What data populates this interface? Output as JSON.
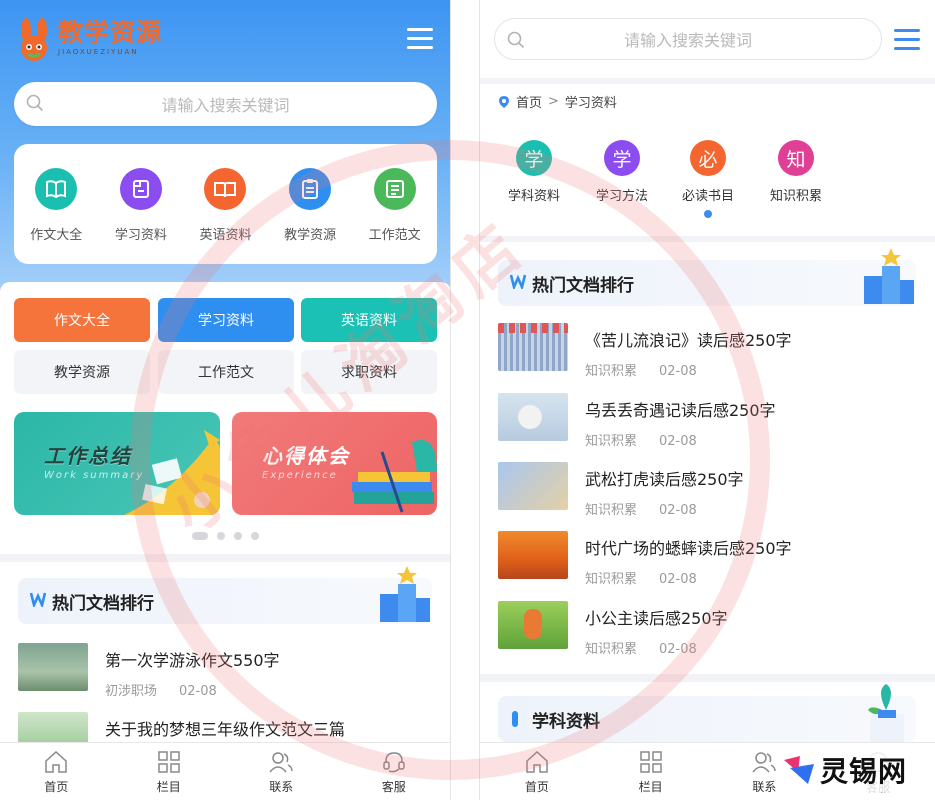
{
  "left": {
    "logo": {
      "title": "教学资源",
      "subtitle": "JIAOXUEZIYUAN"
    },
    "search": {
      "placeholder": "请输入搜索关键词"
    },
    "categories": [
      {
        "label": "作文大全",
        "icon": "book-icon",
        "color": "#1bbfb0"
      },
      {
        "label": "学习资料",
        "icon": "folder-icon",
        "color": "#8b4cf0"
      },
      {
        "label": "英语资料",
        "icon": "open-book-icon",
        "color": "#f4652f"
      },
      {
        "label": "教学资源",
        "icon": "clipboard-icon",
        "color": "#2f8ff0"
      },
      {
        "label": "工作范文",
        "icon": "list-icon",
        "color": "#4bb85a"
      }
    ],
    "pills": [
      {
        "label": "作文大全",
        "color": "#f4743b"
      },
      {
        "label": "学习资料",
        "color": "#2f8ff0"
      },
      {
        "label": "英语资料",
        "color": "#1bc1b4"
      },
      {
        "label": "教学资源",
        "color": ""
      },
      {
        "label": "工作范文",
        "color": ""
      },
      {
        "label": "求职资料",
        "color": ""
      }
    ],
    "banners": [
      {
        "title": "工作总结",
        "subtitle": "Work summary"
      },
      {
        "title": "心得体会",
        "subtitle": "Experience"
      }
    ],
    "hot": {
      "title": "热门文档排行",
      "items": [
        {
          "title": "第一次学游泳作文550字",
          "category": "初涉职场",
          "date": "02-08"
        },
        {
          "title": "关于我的梦想三年级作文范文三篇",
          "category": "",
          "date": ""
        }
      ]
    }
  },
  "right": {
    "search": {
      "placeholder": "请输入搜索关键词"
    },
    "breadcrumb": {
      "home": "首页",
      "separator": ">",
      "current": "学习资料"
    },
    "categories": [
      {
        "char": "学",
        "label": "学科资料",
        "color": "#1bbfb0"
      },
      {
        "char": "学",
        "label": "学习方法",
        "color": "#8b4cf0"
      },
      {
        "char": "必",
        "label": "必读书目",
        "color": "#f4652f"
      },
      {
        "char": "知",
        "label": "知识积累",
        "color": "#e03f96"
      }
    ],
    "hot": {
      "title": "热门文档排行",
      "items": [
        {
          "title": "《苦儿流浪记》读后感250字",
          "category": "知识积累",
          "date": "02-08"
        },
        {
          "title": "乌丢丢奇遇记读后感250字",
          "category": "知识积累",
          "date": "02-08"
        },
        {
          "title": "武松打虎读后感250字",
          "category": "知识积累",
          "date": "02-08"
        },
        {
          "title": "时代广场的蟋蟀读后感250字",
          "category": "知识积累",
          "date": "02-08"
        },
        {
          "title": "小公主读后感250字",
          "category": "知识积累",
          "date": "02-08"
        }
      ]
    },
    "subject": {
      "title": "学科资料"
    }
  },
  "tabbar": [
    {
      "label": "首页",
      "icon": "home-icon"
    },
    {
      "label": "栏目",
      "icon": "grid-icon"
    },
    {
      "label": "联系",
      "icon": "contacts-icon"
    },
    {
      "label": "客服",
      "icon": "headset-icon"
    }
  ],
  "watermark": {
    "text": "小鱼儿淘淘店"
  },
  "brand": {
    "text": "灵锡网"
  },
  "colors": {
    "primary": "#2f8ff0",
    "accent_orange": "#f4743b",
    "teal": "#1bc1b4"
  }
}
